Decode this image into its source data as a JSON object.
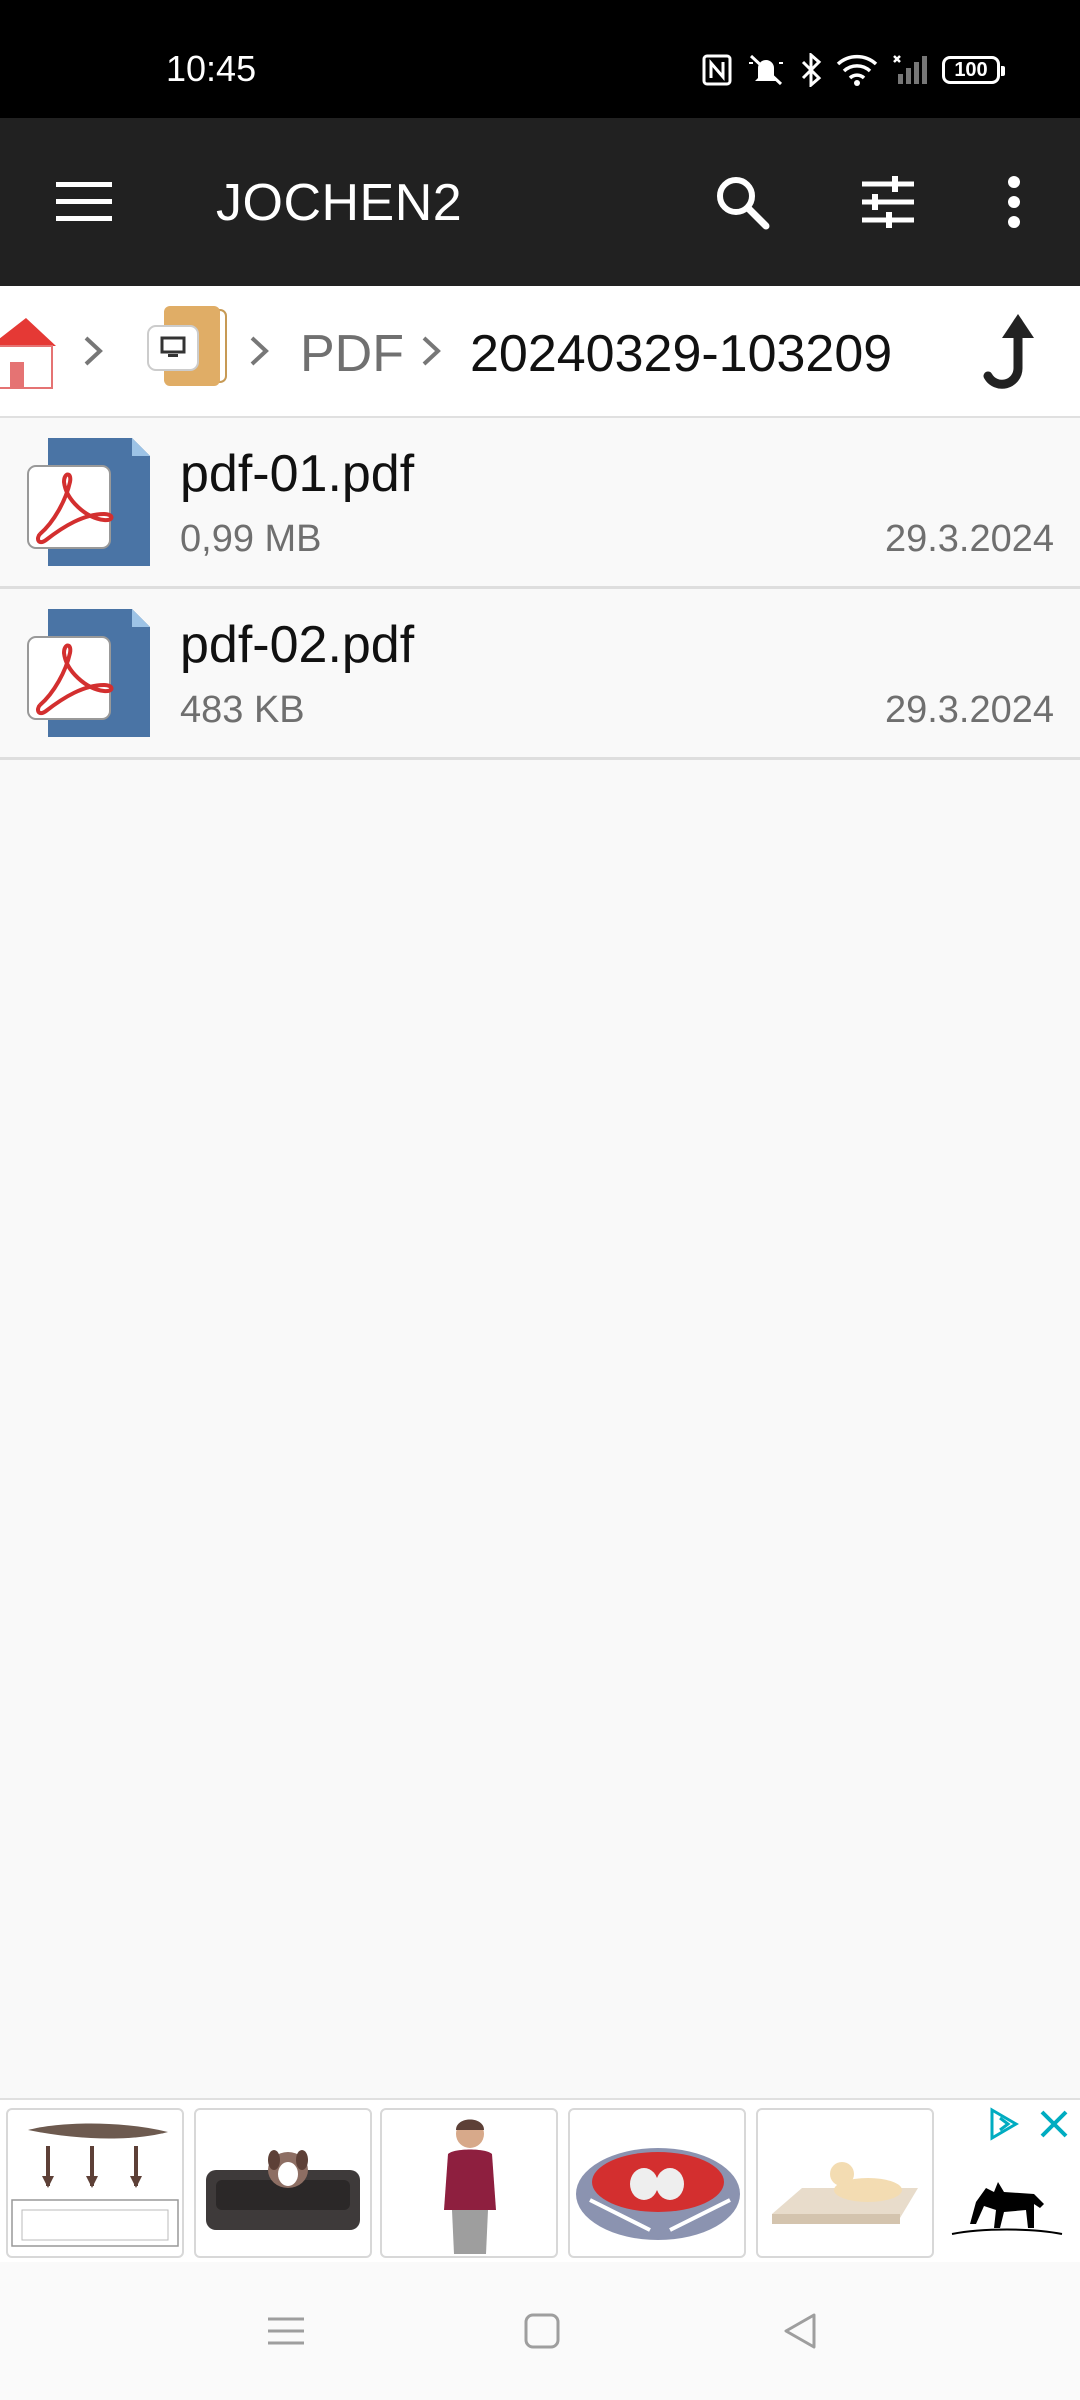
{
  "status_bar": {
    "time": "10:45",
    "battery": "100",
    "icons": [
      "nfc-icon",
      "mute-icon",
      "bluetooth-icon",
      "wifi-icon",
      "signal-icon",
      "battery-icon"
    ]
  },
  "app_bar": {
    "title": "JOCHEN2",
    "actions": [
      "search-icon",
      "filter-icon",
      "more-icon"
    ]
  },
  "breadcrumb": {
    "items": [
      {
        "icon": "home-icon"
      },
      {
        "icon": "device-folder-icon"
      },
      {
        "label": "PDF"
      },
      {
        "label": "20240329-103209"
      }
    ],
    "up_icon": "up-arrow-icon"
  },
  "files": [
    {
      "name": "pdf-01.pdf",
      "size": "0,99 MB",
      "date": "29.3.2024",
      "icon": "pdf-file-icon"
    },
    {
      "name": "pdf-02.pdf",
      "size": "483 KB",
      "date": "29.3.2024",
      "icon": "pdf-file-icon"
    }
  ],
  "ad": {
    "tiles": [
      "dog bed diagram",
      "dog on bed",
      "woman in vest",
      "dog bed union jack",
      "dog on mat"
    ],
    "controls": [
      "adchoices-icon",
      "close-icon"
    ]
  },
  "nav_bar": [
    "recents-icon",
    "home-icon",
    "back-icon"
  ],
  "colors": {
    "status_bar": "#000000",
    "app_bar": "#212121",
    "list_background": "#f9f9f9",
    "pdf_red": "#d32f2f",
    "file_blue": "#4a74a5"
  }
}
